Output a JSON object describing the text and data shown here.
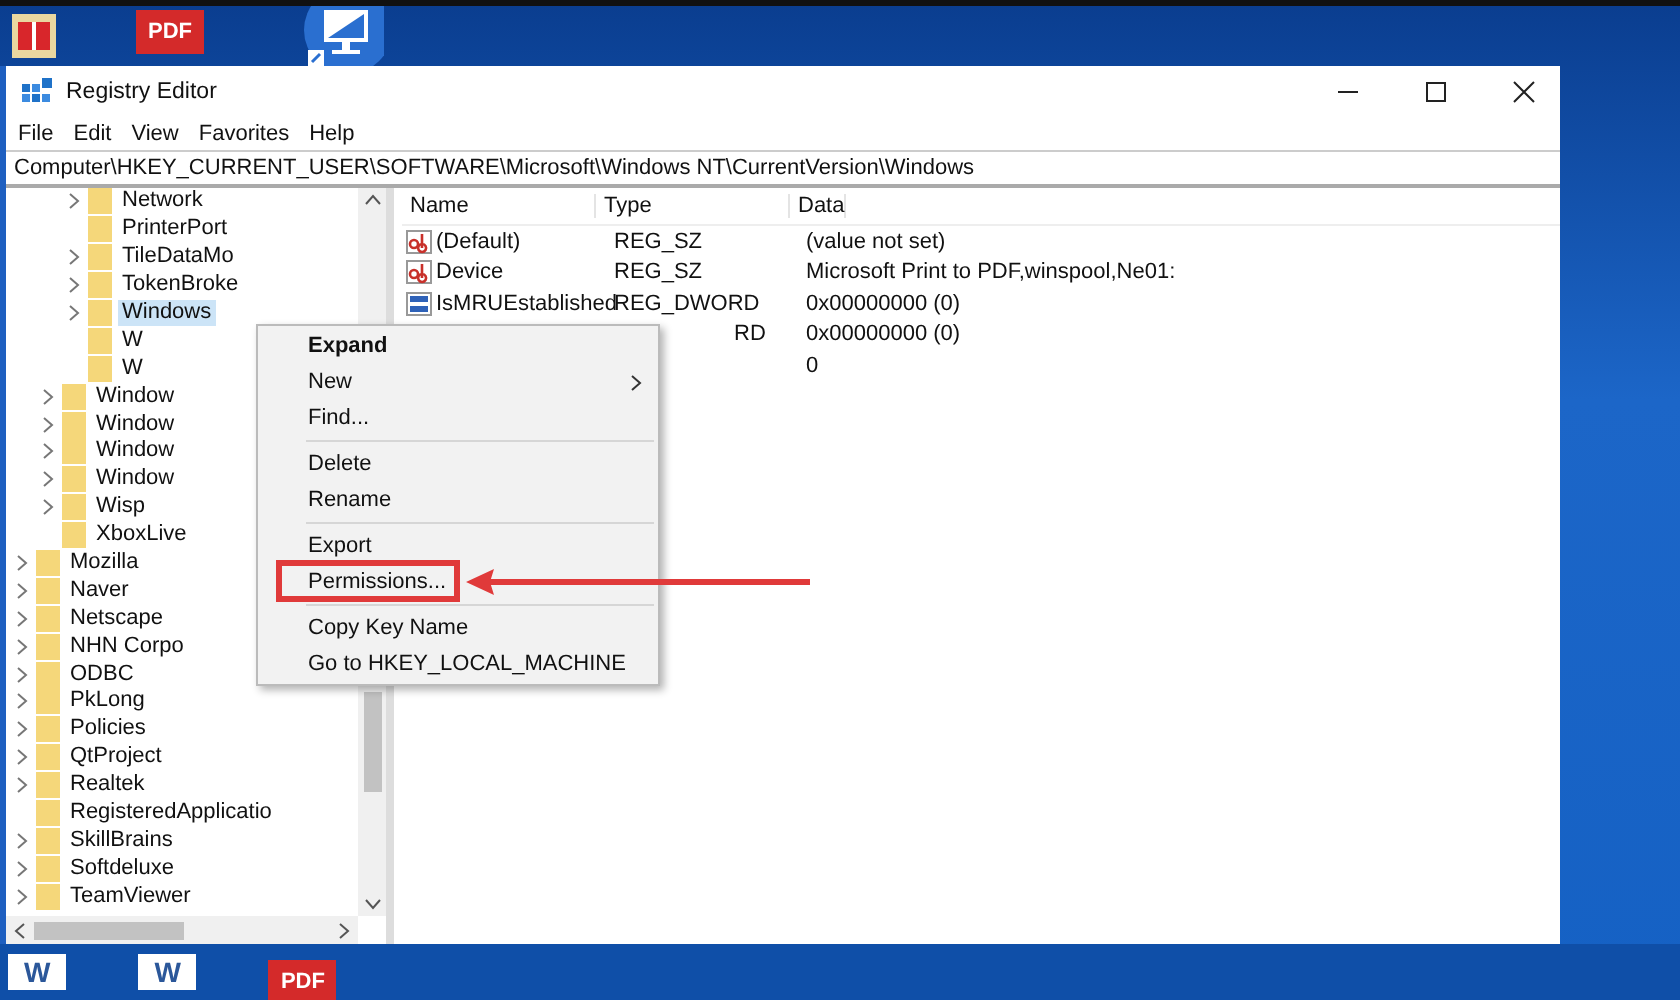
{
  "desktop_icons": [
    {
      "kind": "book"
    },
    {
      "kind": "pdf",
      "label": "PDF"
    },
    {
      "kind": "monitor"
    }
  ],
  "window": {
    "title": "Registry Editor"
  },
  "menu_bar": [
    "File",
    "Edit",
    "View",
    "Favorites",
    "Help"
  ],
  "address": "Computer\\HKEY_CURRENT_USER\\SOFTWARE\\Microsoft\\Windows NT\\CurrentVersion\\Windows",
  "tree": [
    {
      "children": [
        {
          "children": [
            {
              "label": "Network",
              "expandable": true,
              "selected": false
            },
            {
              "label": "PrinterPort",
              "expandable": false,
              "selected": false
            },
            {
              "label": "TileDataMo",
              "expandable": true,
              "selected": false
            },
            {
              "label": "TokenBroke",
              "expandable": true,
              "selected": false
            },
            {
              "label": "Windows",
              "expandable": true,
              "selected": true
            },
            {
              "label": "W",
              "expandable": false,
              "selected": false
            },
            {
              "label": "W",
              "expandable": false,
              "selected": false
            }
          ]
        },
        {
          "label": "Window",
          "expandable": true,
          "selected": false
        },
        {
          "label": "Window",
          "expandable": true,
          "selected": false
        },
        {
          "label": "Window",
          "expandable": true,
          "selected": false
        },
        {
          "label": "Window",
          "expandable": true,
          "selected": false
        },
        {
          "label": "Wisp",
          "expandable": true,
          "selected": false
        },
        {
          "label": "XboxLive",
          "expandable": false,
          "selected": false
        }
      ]
    },
    {
      "label": "Mozilla",
      "expandable": true,
      "selected": false
    },
    {
      "label": "Naver",
      "expandable": true,
      "selected": false
    },
    {
      "label": "Netscape",
      "expandable": true,
      "selected": false
    },
    {
      "label": "NHN Corpo",
      "expandable": true,
      "selected": false
    },
    {
      "label": "ODBC",
      "expandable": true,
      "selected": false
    },
    {
      "label": "PkLong",
      "expandable": true,
      "selected": false
    },
    {
      "label": "Policies",
      "expandable": true,
      "selected": false
    },
    {
      "label": "QtProject",
      "expandable": true,
      "selected": false
    },
    {
      "label": "Realtek",
      "expandable": true,
      "selected": false
    },
    {
      "label": "RegisteredApplicatio",
      "expandable": false,
      "selected": false
    },
    {
      "label": "SkillBrains",
      "expandable": true,
      "selected": false
    },
    {
      "label": "Softdeluxe",
      "expandable": true,
      "selected": false
    },
    {
      "label": "TeamViewer",
      "expandable": true,
      "selected": false
    }
  ],
  "values": {
    "columns": [
      "Name",
      "Type",
      "Data"
    ],
    "rows": [
      {
        "kind": "string",
        "name": "(Default)",
        "type": "REG_SZ",
        "data": "(value not set)"
      },
      {
        "kind": "string",
        "name": "Device",
        "type": "REG_SZ",
        "data": "Microsoft Print to PDF,winspool,Ne01:"
      },
      {
        "kind": "dword",
        "name": "IsMRUEstablished",
        "type": "REG_DWORD",
        "data": "0x00000000 (0)"
      },
      {
        "type": "RD",
        "data": "0x00000000 (0)"
      },
      {
        "data": "0"
      }
    ]
  },
  "context_menu": [
    {
      "kind": "item",
      "label": "Expand",
      "default": true,
      "submenu": false,
      "highlighted": false
    },
    {
      "kind": "item",
      "label": "New",
      "default": false,
      "submenu": true,
      "highlighted": false
    },
    {
      "kind": "item",
      "label": "Find...",
      "default": false,
      "submenu": false,
      "highlighted": false
    },
    {
      "kind": "separator"
    },
    {
      "kind": "item",
      "label": "Delete",
      "default": false,
      "submenu": false,
      "highlighted": false
    },
    {
      "kind": "item",
      "label": "Rename",
      "default": false,
      "submenu": false,
      "highlighted": false
    },
    {
      "kind": "separator"
    },
    {
      "kind": "item",
      "label": "Export",
      "default": false,
      "submenu": false,
      "highlighted": false
    },
    {
      "kind": "item",
      "label": "Permissions...",
      "default": false,
      "submenu": false,
      "highlighted": true
    },
    {
      "kind": "separator"
    },
    {
      "kind": "item",
      "label": "Copy Key Name",
      "default": false,
      "submenu": false,
      "highlighted": false
    },
    {
      "kind": "item",
      "label": "Go to HKEY_LOCAL_MACHINE",
      "default": false,
      "submenu": false,
      "highlighted": false
    }
  ],
  "taskbar": [
    {
      "kind": "word",
      "label": "W"
    },
    {
      "kind": "word",
      "label": "W"
    },
    {
      "kind": "pdf",
      "label": "PDF"
    }
  ]
}
